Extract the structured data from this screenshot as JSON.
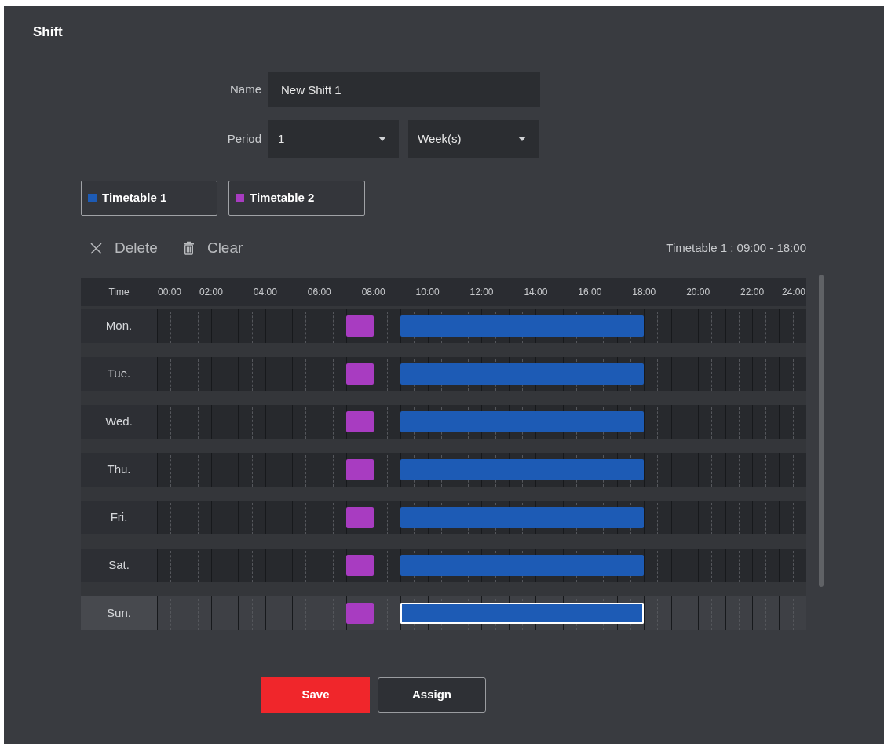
{
  "title": "Shift",
  "form": {
    "name": {
      "label": "Name",
      "value": "New Shift 1"
    },
    "period": {
      "label": "Period",
      "selects": [
        {
          "value": "1"
        },
        {
          "value": "Week(s)"
        }
      ]
    }
  },
  "timetables": [
    {
      "label": "Timetable 1",
      "color": "#1d5bb5"
    },
    {
      "label": "Timetable 2",
      "color": "#a83cc1"
    }
  ],
  "toolbar": [
    {
      "kind": "delete",
      "label": "Delete"
    },
    {
      "kind": "clear",
      "label": "Clear"
    }
  ],
  "selection_info": "Timetable 1 : 09:00 - 18:00",
  "schedule": {
    "time_header": "Time",
    "ticks": [
      "00:00",
      "02:00",
      "04:00",
      "06:00",
      "08:00",
      "10:00",
      "12:00",
      "14:00",
      "16:00",
      "18:00",
      "20:00",
      "22:00",
      "24:00"
    ],
    "days": [
      {
        "label": "Mon.",
        "selected": false,
        "hours": [
          {
            "selected": false
          },
          {
            "selected": false
          },
          {
            "selected": false
          },
          {
            "selected": false
          },
          {
            "selected": false
          },
          {
            "selected": false
          },
          {
            "selected": false
          },
          {
            "color": "#a83cc1",
            "selected": false
          },
          {
            "selected": false
          },
          {
            "color": "#1d5bb5",
            "selected": false
          },
          {
            "color": "#1d5bb5",
            "selected": false
          },
          {
            "color": "#1d5bb5",
            "selected": false
          },
          {
            "color": "#1d5bb5",
            "selected": false
          },
          {
            "color": "#1d5bb5",
            "selected": false
          },
          {
            "color": "#1d5bb5",
            "selected": false
          },
          {
            "color": "#1d5bb5",
            "selected": false
          },
          {
            "color": "#1d5bb5",
            "selected": false
          },
          {
            "color": "#1d5bb5",
            "selected": false
          },
          {
            "selected": false
          },
          {
            "selected": false
          },
          {
            "selected": false
          },
          {
            "selected": false
          },
          {
            "selected": false
          },
          {
            "selected": false
          }
        ]
      },
      {
        "label": "Tue.",
        "selected": false,
        "hours": [
          {
            "selected": false
          },
          {
            "selected": false
          },
          {
            "selected": false
          },
          {
            "selected": false
          },
          {
            "selected": false
          },
          {
            "selected": false
          },
          {
            "selected": false
          },
          {
            "color": "#a83cc1",
            "selected": false
          },
          {
            "selected": false
          },
          {
            "color": "#1d5bb5",
            "selected": false
          },
          {
            "color": "#1d5bb5",
            "selected": false
          },
          {
            "color": "#1d5bb5",
            "selected": false
          },
          {
            "color": "#1d5bb5",
            "selected": false
          },
          {
            "color": "#1d5bb5",
            "selected": false
          },
          {
            "color": "#1d5bb5",
            "selected": false
          },
          {
            "color": "#1d5bb5",
            "selected": false
          },
          {
            "color": "#1d5bb5",
            "selected": false
          },
          {
            "color": "#1d5bb5",
            "selected": false
          },
          {
            "selected": false
          },
          {
            "selected": false
          },
          {
            "selected": false
          },
          {
            "selected": false
          },
          {
            "selected": false
          },
          {
            "selected": false
          }
        ]
      },
      {
        "label": "Wed.",
        "selected": false,
        "hours": [
          {
            "selected": false
          },
          {
            "selected": false
          },
          {
            "selected": false
          },
          {
            "selected": false
          },
          {
            "selected": false
          },
          {
            "selected": false
          },
          {
            "selected": false
          },
          {
            "color": "#a83cc1",
            "selected": false
          },
          {
            "selected": false
          },
          {
            "color": "#1d5bb5",
            "selected": false
          },
          {
            "color": "#1d5bb5",
            "selected": false
          },
          {
            "color": "#1d5bb5",
            "selected": false
          },
          {
            "color": "#1d5bb5",
            "selected": false
          },
          {
            "color": "#1d5bb5",
            "selected": false
          },
          {
            "color": "#1d5bb5",
            "selected": false
          },
          {
            "color": "#1d5bb5",
            "selected": false
          },
          {
            "color": "#1d5bb5",
            "selected": false
          },
          {
            "color": "#1d5bb5",
            "selected": false
          },
          {
            "selected": false
          },
          {
            "selected": false
          },
          {
            "selected": false
          },
          {
            "selected": false
          },
          {
            "selected": false
          },
          {
            "selected": false
          }
        ]
      },
      {
        "label": "Thu.",
        "selected": false,
        "hours": [
          {
            "selected": false
          },
          {
            "selected": false
          },
          {
            "selected": false
          },
          {
            "selected": false
          },
          {
            "selected": false
          },
          {
            "selected": false
          },
          {
            "selected": false
          },
          {
            "color": "#a83cc1",
            "selected": false
          },
          {
            "selected": false
          },
          {
            "color": "#1d5bb5",
            "selected": false
          },
          {
            "color": "#1d5bb5",
            "selected": false
          },
          {
            "color": "#1d5bb5",
            "selected": false
          },
          {
            "color": "#1d5bb5",
            "selected": false
          },
          {
            "color": "#1d5bb5",
            "selected": false
          },
          {
            "color": "#1d5bb5",
            "selected": false
          },
          {
            "color": "#1d5bb5",
            "selected": false
          },
          {
            "color": "#1d5bb5",
            "selected": false
          },
          {
            "color": "#1d5bb5",
            "selected": false
          },
          {
            "selected": false
          },
          {
            "selected": false
          },
          {
            "selected": false
          },
          {
            "selected": false
          },
          {
            "selected": false
          },
          {
            "selected": false
          }
        ]
      },
      {
        "label": "Fri.",
        "selected": false,
        "hours": [
          {
            "selected": false
          },
          {
            "selected": false
          },
          {
            "selected": false
          },
          {
            "selected": false
          },
          {
            "selected": false
          },
          {
            "selected": false
          },
          {
            "selected": false
          },
          {
            "color": "#a83cc1",
            "selected": false
          },
          {
            "selected": false
          },
          {
            "color": "#1d5bb5",
            "selected": false
          },
          {
            "color": "#1d5bb5",
            "selected": false
          },
          {
            "color": "#1d5bb5",
            "selected": false
          },
          {
            "color": "#1d5bb5",
            "selected": false
          },
          {
            "color": "#1d5bb5",
            "selected": false
          },
          {
            "color": "#1d5bb5",
            "selected": false
          },
          {
            "color": "#1d5bb5",
            "selected": false
          },
          {
            "color": "#1d5bb5",
            "selected": false
          },
          {
            "color": "#1d5bb5",
            "selected": false
          },
          {
            "selected": false
          },
          {
            "selected": false
          },
          {
            "selected": false
          },
          {
            "selected": false
          },
          {
            "selected": false
          },
          {
            "selected": false
          }
        ]
      },
      {
        "label": "Sat.",
        "selected": false,
        "hours": [
          {
            "selected": false
          },
          {
            "selected": false
          },
          {
            "selected": false
          },
          {
            "selected": false
          },
          {
            "selected": false
          },
          {
            "selected": false
          },
          {
            "selected": false
          },
          {
            "color": "#a83cc1",
            "selected": false
          },
          {
            "selected": false
          },
          {
            "color": "#1d5bb5",
            "selected": false
          },
          {
            "color": "#1d5bb5",
            "selected": false
          },
          {
            "color": "#1d5bb5",
            "selected": false
          },
          {
            "color": "#1d5bb5",
            "selected": false
          },
          {
            "color": "#1d5bb5",
            "selected": false
          },
          {
            "color": "#1d5bb5",
            "selected": false
          },
          {
            "color": "#1d5bb5",
            "selected": false
          },
          {
            "color": "#1d5bb5",
            "selected": false
          },
          {
            "color": "#1d5bb5",
            "selected": false
          },
          {
            "selected": false
          },
          {
            "selected": false
          },
          {
            "selected": false
          },
          {
            "selected": false
          },
          {
            "selected": false
          },
          {
            "selected": false
          }
        ]
      },
      {
        "label": "Sun.",
        "selected": true,
        "hours": [
          {
            "selected": false
          },
          {
            "selected": false
          },
          {
            "selected": false
          },
          {
            "selected": false
          },
          {
            "selected": false
          },
          {
            "selected": false
          },
          {
            "selected": false
          },
          {
            "color": "#a83cc1",
            "selected": false
          },
          {
            "selected": false
          },
          {
            "color": "#1d5bb5",
            "selected": true
          },
          {
            "color": "#1d5bb5",
            "selected": true
          },
          {
            "color": "#1d5bb5",
            "selected": true
          },
          {
            "color": "#1d5bb5",
            "selected": true
          },
          {
            "color": "#1d5bb5",
            "selected": true
          },
          {
            "color": "#1d5bb5",
            "selected": true
          },
          {
            "color": "#1d5bb5",
            "selected": true
          },
          {
            "color": "#1d5bb5",
            "selected": true
          },
          {
            "color": "#1d5bb5",
            "selected": true
          },
          {
            "selected": false
          },
          {
            "selected": false
          },
          {
            "selected": false
          },
          {
            "selected": false
          },
          {
            "selected": false
          },
          {
            "selected": false
          }
        ]
      }
    ]
  },
  "buttons": [
    {
      "kind": "primary",
      "label": "Save"
    },
    {
      "kind": "secondary",
      "label": "Assign"
    }
  ]
}
